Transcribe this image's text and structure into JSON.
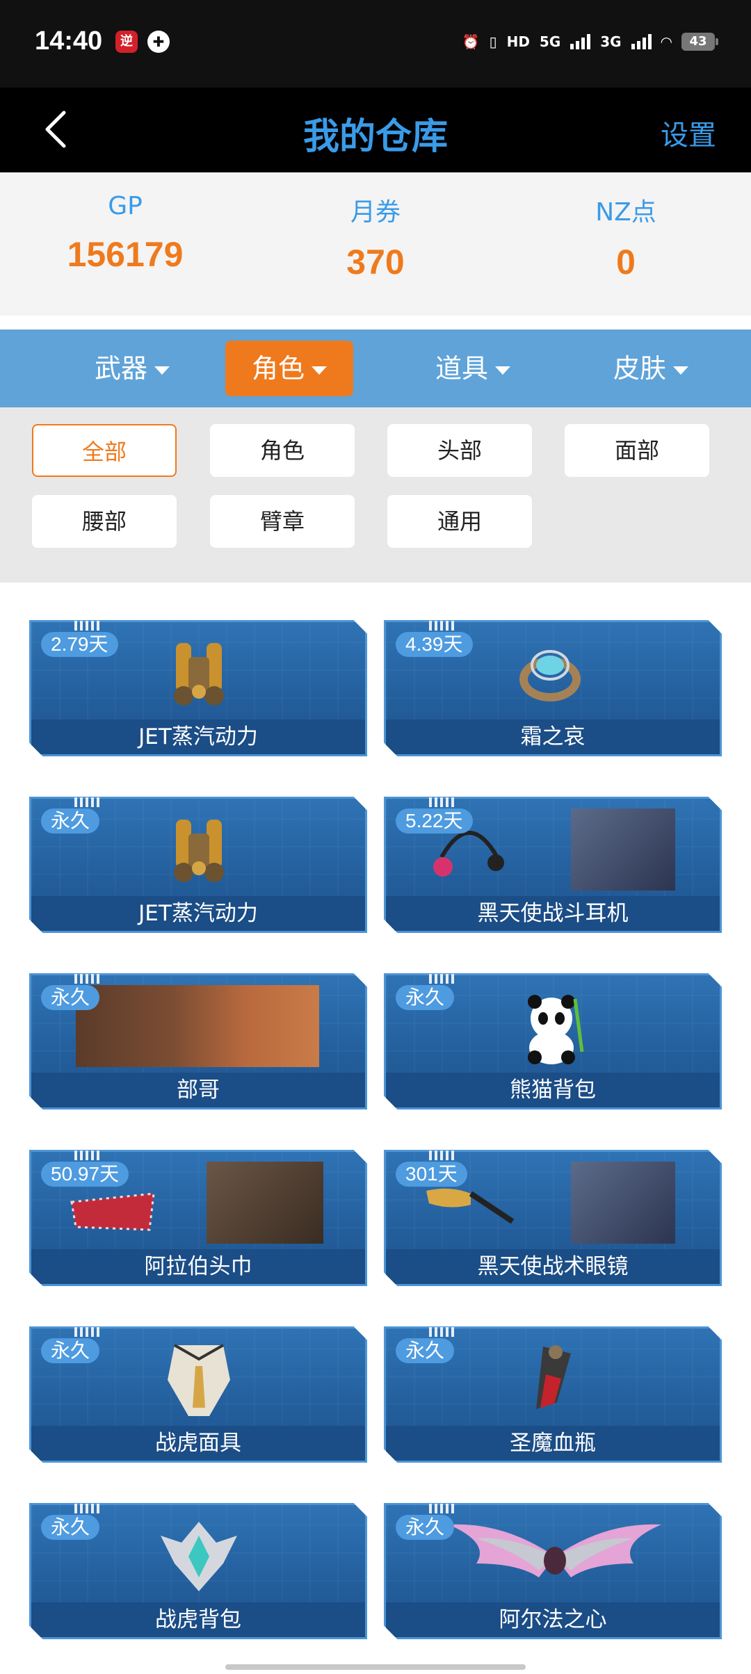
{
  "status_bar": {
    "time": "14:40",
    "battery": "43",
    "network_5g": "5G",
    "network_3g": "3G",
    "hd": "HD"
  },
  "header": {
    "title": "我的仓库",
    "settings": "设置"
  },
  "currency": [
    {
      "label": "GP",
      "value": "156179"
    },
    {
      "label": "月券",
      "value": "370"
    },
    {
      "label": "NZ点",
      "value": "0"
    }
  ],
  "categories": [
    "武器",
    "角色",
    "道具",
    "皮肤"
  ],
  "active_category": "角色",
  "filters": [
    "全部",
    "角色",
    "头部",
    "面部",
    "腰部",
    "臂章",
    "通用"
  ],
  "active_filter": "全部",
  "items": [
    {
      "name": "JET蒸汽动力",
      "duration": "2.79天",
      "icon": "jetpack-icon"
    },
    {
      "name": "霜之哀",
      "duration": "4.39天",
      "icon": "ring-icon"
    },
    {
      "name": "JET蒸汽动力",
      "duration": "永久",
      "icon": "jetpack-icon"
    },
    {
      "name": "黑天使战斗耳机",
      "duration": "5.22天",
      "icon": "headphones-icon"
    },
    {
      "name": "部哥",
      "duration": "永久",
      "icon": "character-portrait-icon"
    },
    {
      "name": "熊猫背包",
      "duration": "永久",
      "icon": "panda-icon"
    },
    {
      "name": "阿拉伯头巾",
      "duration": "50.97天",
      "icon": "headscarf-icon"
    },
    {
      "name": "黑天使战术眼镜",
      "duration": "301天",
      "icon": "glasses-icon"
    },
    {
      "name": "战虎面具",
      "duration": "永久",
      "icon": "mask-icon"
    },
    {
      "name": "圣魔血瓶",
      "duration": "永久",
      "icon": "blood-vial-icon"
    },
    {
      "name": "战虎背包",
      "duration": "永久",
      "icon": "tiger-backpack-icon"
    },
    {
      "name": "阿尔法之心",
      "duration": "永久",
      "icon": "wings-icon"
    }
  ],
  "colors": {
    "accent_blue": "#3a9be8",
    "accent_orange": "#ef7a1d",
    "card_blue": "#235e9c"
  }
}
